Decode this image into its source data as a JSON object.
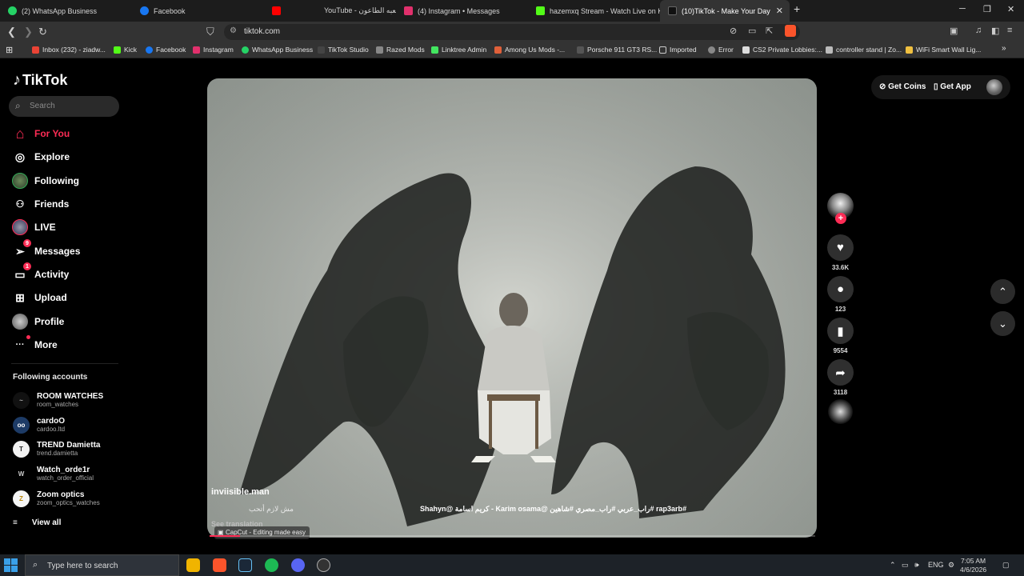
{
  "browser": {
    "tabs": [
      {
        "label": "(2) WhatsApp Business",
        "color": "#25d366"
      },
      {
        "label": "Facebook",
        "color": "#1877f2"
      },
      {
        "label": "YouTube - لعبه الطاعون",
        "color": "#ff0000"
      },
      {
        "label": "(4) Instagram • Messages",
        "color": "#e1306c"
      },
      {
        "label": "hazemxq Stream - Watch Live on Kick",
        "color": "#53fc18"
      },
      {
        "label": "(10)TikTok - Make Your Day",
        "color": "#111111"
      }
    ],
    "new_tab": "+",
    "url": "tiktok.com",
    "bookmarks": [
      {
        "label": "Inbox (232) - ziadw...",
        "color": "#ea4335"
      },
      {
        "label": "Kick",
        "color": "#53fc18"
      },
      {
        "label": "Facebook",
        "color": "#1877f2"
      },
      {
        "label": "Instagram",
        "color": "#e1306c"
      },
      {
        "label": "WhatsApp Business",
        "color": "#25d366"
      },
      {
        "label": "TikTok Studio",
        "color": "#444444"
      },
      {
        "label": "Razed Mods",
        "color": "#888888"
      },
      {
        "label": "Linktree Admin",
        "color": "#43e660"
      },
      {
        "label": "Among Us Mods -...",
        "color": "#e0603a"
      },
      {
        "label": "Porsche 911 GT3 RS...",
        "color": "#555555"
      },
      {
        "label": "Imported",
        "color": "#777777"
      },
      {
        "label": "Error",
        "color": "#888888"
      },
      {
        "label": "CS2 Private Lobbies:...",
        "color": "#dddddd"
      },
      {
        "label": "controller stand | Zo...",
        "color": "#bbbbbb"
      },
      {
        "label": "WiFi Smart Wall Lig...",
        "color": "#f0c040"
      }
    ]
  },
  "tiktok": {
    "brand": "TikTok",
    "search_placeholder": "Search",
    "nav": [
      {
        "label": "For You",
        "icon": "home-icon",
        "glyph": "⌂"
      },
      {
        "label": "Explore",
        "icon": "compass-icon",
        "glyph": "◎"
      },
      {
        "label": "Following",
        "icon": "avatar",
        "glyph": ""
      },
      {
        "label": "Friends",
        "icon": "friends-icon",
        "glyph": "👥"
      },
      {
        "label": "LIVE",
        "icon": "live-avatar",
        "glyph": ""
      },
      {
        "label": "Messages",
        "icon": "send-icon",
        "glyph": "➤",
        "badge": "9"
      },
      {
        "label": "Activity",
        "icon": "activity-icon",
        "glyph": "▭",
        "badge": "1"
      },
      {
        "label": "Upload",
        "icon": "upload-icon",
        "glyph": "⊞"
      },
      {
        "label": "Profile",
        "icon": "profile-avatar",
        "glyph": ""
      },
      {
        "label": "More",
        "icon": "more-icon",
        "glyph": "···"
      }
    ],
    "following_title": "Following accounts",
    "accounts": [
      {
        "name": "ROOM WATCHES",
        "handle": "room_watches",
        "initials": "~",
        "bg": "#111111"
      },
      {
        "name": "cardoO",
        "handle": "cardoo.ltd",
        "initials": "oo",
        "bg": "#1d3b66"
      },
      {
        "name": "TREND Damietta",
        "handle": "trend.damietta",
        "initials": "T",
        "bg": "#f2f2f2"
      },
      {
        "name": "Watch_orde1r",
        "handle": "watch_order_official",
        "initials": "W",
        "bg": "#000000"
      },
      {
        "name": "Zoom optics",
        "handle": "zoom_optics_watches",
        "initials": "Z",
        "bg": "#f5f5f5"
      }
    ],
    "view_all": "View all",
    "top_actions": {
      "coins": "Get Coins",
      "app": "Get App"
    },
    "video": {
      "capcut": "CapCut - Editing made easy",
      "author": "inviisible.man",
      "caption_ar": "مش لازم أتحب",
      "hashtags": "#rap3arb #راب_عربي #راب_مصري #شاهين @Karim osama - كريم اسامة @Shahyn",
      "see_translation": "See translation",
      "progress": 0.05
    },
    "actions": {
      "likes": "33.6K",
      "comments": "123",
      "saves": "9554",
      "shares": "3118"
    }
  },
  "taskbar": {
    "search_placeholder": "Type here to search",
    "language": "ENG",
    "time": "7:05 AM",
    "date": "4/6/2026"
  }
}
